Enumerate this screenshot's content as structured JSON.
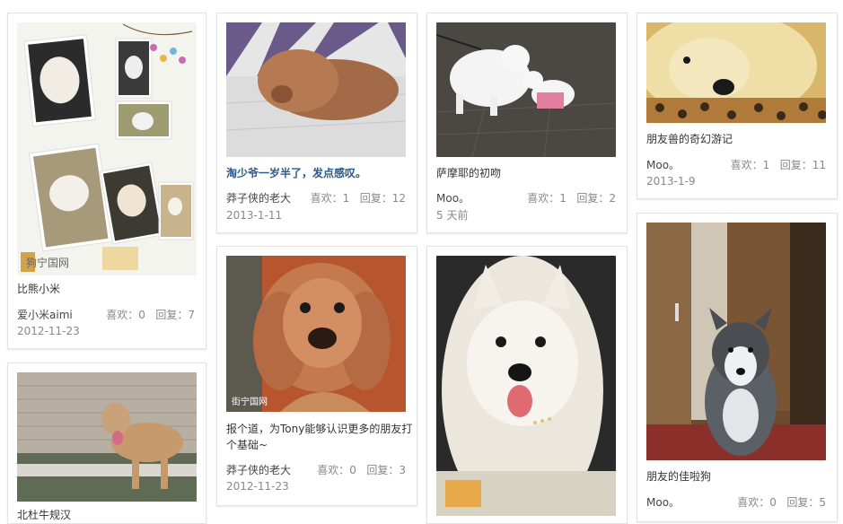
{
  "labels": {
    "likes": "喜欢：",
    "replies": "回复："
  },
  "cards": [
    {
      "title": "比熊小米",
      "user": "爱小米aimi",
      "likes": "0",
      "replies": "7",
      "date": "2012-11-23",
      "watermark": "狗宁国网"
    },
    {
      "title": "北杜牛规汉",
      "user": "",
      "likes": "",
      "replies": "",
      "date": ""
    },
    {
      "title": "淘少爷一岁半了，发点感叹。",
      "user": "莽子侠的老大",
      "likes": "1",
      "replies": "12",
      "date": "2013-1-11"
    },
    {
      "title": "报个道，为Tony能够认识更多的朋友打个基础~",
      "user": "莽子侠的老大",
      "likes": "0",
      "replies": "3",
      "date": "2012-11-23",
      "watermark": "街宁国网"
    },
    {
      "title": "萨摩耶的初吻",
      "user": "Moo。",
      "likes": "1",
      "replies": "2",
      "date": "5 天前"
    },
    {
      "title": "",
      "user": "",
      "likes": "",
      "replies": "",
      "date": ""
    },
    {
      "title": "朋友兽的奇幻游记",
      "user": "Moo。",
      "likes": "1",
      "replies": "11",
      "date": "2013-1-9"
    },
    {
      "title": "朋友的佳啦狗",
      "user": "Moo。",
      "likes": "0",
      "replies": "5",
      "date": ""
    }
  ]
}
